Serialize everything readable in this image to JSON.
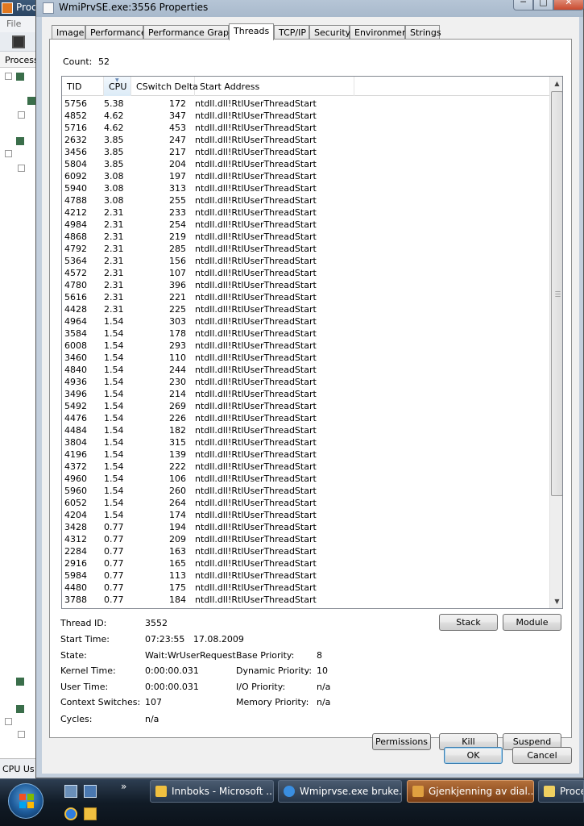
{
  "background_window": {
    "title": "Proc",
    "menu_file": "File",
    "tree_header": "Process",
    "status_text": "CPU Us"
  },
  "dialog": {
    "title": "WmiPrvSE.exe:3556 Properties"
  },
  "tabs": [
    {
      "label": "Image"
    },
    {
      "label": "Performance"
    },
    {
      "label": "Performance Graph"
    },
    {
      "label": "Threads",
      "active": true
    },
    {
      "label": "TCP/IP"
    },
    {
      "label": "Security"
    },
    {
      "label": "Environment"
    },
    {
      "label": "Strings"
    }
  ],
  "threads": {
    "count_label": "Count:",
    "count_value": "52",
    "columns": {
      "tid": "TID",
      "cpu": "CPU",
      "cswitch": "CSwitch Delta",
      "start": "Start Address"
    },
    "rows": [
      {
        "tid": "5756",
        "cpu": "5.38",
        "cs": "172",
        "addr": "ntdll.dll!RtlUserThreadStart"
      },
      {
        "tid": "4852",
        "cpu": "4.62",
        "cs": "347",
        "addr": "ntdll.dll!RtlUserThreadStart"
      },
      {
        "tid": "5716",
        "cpu": "4.62",
        "cs": "453",
        "addr": "ntdll.dll!RtlUserThreadStart"
      },
      {
        "tid": "2632",
        "cpu": "3.85",
        "cs": "247",
        "addr": "ntdll.dll!RtlUserThreadStart"
      },
      {
        "tid": "3456",
        "cpu": "3.85",
        "cs": "217",
        "addr": "ntdll.dll!RtlUserThreadStart"
      },
      {
        "tid": "5804",
        "cpu": "3.85",
        "cs": "204",
        "addr": "ntdll.dll!RtlUserThreadStart"
      },
      {
        "tid": "6092",
        "cpu": "3.08",
        "cs": "197",
        "addr": "ntdll.dll!RtlUserThreadStart"
      },
      {
        "tid": "5940",
        "cpu": "3.08",
        "cs": "313",
        "addr": "ntdll.dll!RtlUserThreadStart"
      },
      {
        "tid": "4788",
        "cpu": "3.08",
        "cs": "255",
        "addr": "ntdll.dll!RtlUserThreadStart"
      },
      {
        "tid": "4212",
        "cpu": "2.31",
        "cs": "233",
        "addr": "ntdll.dll!RtlUserThreadStart"
      },
      {
        "tid": "4984",
        "cpu": "2.31",
        "cs": "254",
        "addr": "ntdll.dll!RtlUserThreadStart"
      },
      {
        "tid": "4868",
        "cpu": "2.31",
        "cs": "219",
        "addr": "ntdll.dll!RtlUserThreadStart"
      },
      {
        "tid": "4792",
        "cpu": "2.31",
        "cs": "285",
        "addr": "ntdll.dll!RtlUserThreadStart"
      },
      {
        "tid": "5364",
        "cpu": "2.31",
        "cs": "156",
        "addr": "ntdll.dll!RtlUserThreadStart"
      },
      {
        "tid": "4572",
        "cpu": "2.31",
        "cs": "107",
        "addr": "ntdll.dll!RtlUserThreadStart"
      },
      {
        "tid": "4780",
        "cpu": "2.31",
        "cs": "396",
        "addr": "ntdll.dll!RtlUserThreadStart"
      },
      {
        "tid": "5616",
        "cpu": "2.31",
        "cs": "221",
        "addr": "ntdll.dll!RtlUserThreadStart"
      },
      {
        "tid": "4428",
        "cpu": "2.31",
        "cs": "225",
        "addr": "ntdll.dll!RtlUserThreadStart"
      },
      {
        "tid": "4964",
        "cpu": "1.54",
        "cs": "303",
        "addr": "ntdll.dll!RtlUserThreadStart"
      },
      {
        "tid": "3584",
        "cpu": "1.54",
        "cs": "178",
        "addr": "ntdll.dll!RtlUserThreadStart"
      },
      {
        "tid": "6008",
        "cpu": "1.54",
        "cs": "293",
        "addr": "ntdll.dll!RtlUserThreadStart"
      },
      {
        "tid": "3460",
        "cpu": "1.54",
        "cs": "110",
        "addr": "ntdll.dll!RtlUserThreadStart"
      },
      {
        "tid": "4840",
        "cpu": "1.54",
        "cs": "244",
        "addr": "ntdll.dll!RtlUserThreadStart"
      },
      {
        "tid": "4936",
        "cpu": "1.54",
        "cs": "230",
        "addr": "ntdll.dll!RtlUserThreadStart"
      },
      {
        "tid": "3496",
        "cpu": "1.54",
        "cs": "214",
        "addr": "ntdll.dll!RtlUserThreadStart"
      },
      {
        "tid": "5492",
        "cpu": "1.54",
        "cs": "269",
        "addr": "ntdll.dll!RtlUserThreadStart"
      },
      {
        "tid": "4476",
        "cpu": "1.54",
        "cs": "226",
        "addr": "ntdll.dll!RtlUserThreadStart"
      },
      {
        "tid": "4484",
        "cpu": "1.54",
        "cs": "182",
        "addr": "ntdll.dll!RtlUserThreadStart"
      },
      {
        "tid": "3804",
        "cpu": "1.54",
        "cs": "315",
        "addr": "ntdll.dll!RtlUserThreadStart"
      },
      {
        "tid": "4196",
        "cpu": "1.54",
        "cs": "139",
        "addr": "ntdll.dll!RtlUserThreadStart"
      },
      {
        "tid": "4372",
        "cpu": "1.54",
        "cs": "222",
        "addr": "ntdll.dll!RtlUserThreadStart"
      },
      {
        "tid": "4960",
        "cpu": "1.54",
        "cs": "106",
        "addr": "ntdll.dll!RtlUserThreadStart"
      },
      {
        "tid": "5960",
        "cpu": "1.54",
        "cs": "260",
        "addr": "ntdll.dll!RtlUserThreadStart"
      },
      {
        "tid": "6052",
        "cpu": "1.54",
        "cs": "264",
        "addr": "ntdll.dll!RtlUserThreadStart"
      },
      {
        "tid": "4204",
        "cpu": "1.54",
        "cs": "174",
        "addr": "ntdll.dll!RtlUserThreadStart"
      },
      {
        "tid": "3428",
        "cpu": "0.77",
        "cs": "194",
        "addr": "ntdll.dll!RtlUserThreadStart"
      },
      {
        "tid": "4312",
        "cpu": "0.77",
        "cs": "209",
        "addr": "ntdll.dll!RtlUserThreadStart"
      },
      {
        "tid": "2284",
        "cpu": "0.77",
        "cs": "163",
        "addr": "ntdll.dll!RtlUserThreadStart"
      },
      {
        "tid": "2916",
        "cpu": "0.77",
        "cs": "165",
        "addr": "ntdll.dll!RtlUserThreadStart"
      },
      {
        "tid": "5984",
        "cpu": "0.77",
        "cs": "113",
        "addr": "ntdll.dll!RtlUserThreadStart"
      },
      {
        "tid": "4480",
        "cpu": "0.77",
        "cs": "175",
        "addr": "ntdll.dll!RtlUserThreadStart"
      },
      {
        "tid": "3788",
        "cpu": "0.77",
        "cs": "184",
        "addr": "ntdll.dll!RtlUserThreadStart"
      }
    ]
  },
  "details": {
    "thread_id_label": "Thread ID:",
    "thread_id": "3552",
    "start_time_label": "Start Time:",
    "start_time": "07:23:55   17.08.2009",
    "state_label": "State:",
    "state": "Wait:WrUserRequest",
    "kernel_time_label": "Kernel Time:",
    "kernel_time": "0:00:00.031",
    "user_time_label": "User Time:",
    "user_time": "0:00:00.031",
    "context_switches_label": "Context Switches:",
    "context_switches": "107",
    "cycles_label": "Cycles:",
    "cycles": "n/a",
    "base_priority_label": "Base Priority:",
    "base_priority": "8",
    "dynamic_priority_label": "Dynamic Priority:",
    "dynamic_priority": "10",
    "io_priority_label": "I/O Priority:",
    "io_priority": "n/a",
    "memory_priority_label": "Memory Priority:",
    "memory_priority": "n/a"
  },
  "buttons": {
    "stack": "Stack",
    "module": "Module",
    "permissions": "Permissions",
    "kill": "Kill",
    "suspend": "Suspend",
    "ok": "OK",
    "cancel": "Cancel"
  },
  "taskbar": {
    "more": "»",
    "tasks": [
      {
        "label": "Innboks - Microsoft ...",
        "icon_color": "#f0c040"
      },
      {
        "label": "Wmiprvse.exe bruke...",
        "icon_color": "#3a8ee0"
      },
      {
        "label": "Gjenkjenning av dial...",
        "icon_color": "#e0a040",
        "active": true
      },
      {
        "label": "Proce",
        "icon_color": "#f0d060"
      }
    ]
  },
  "colors": {
    "taskbar": "#111b26",
    "active_task": "#b4703a",
    "dialog_frame": "#c3cfdd"
  }
}
